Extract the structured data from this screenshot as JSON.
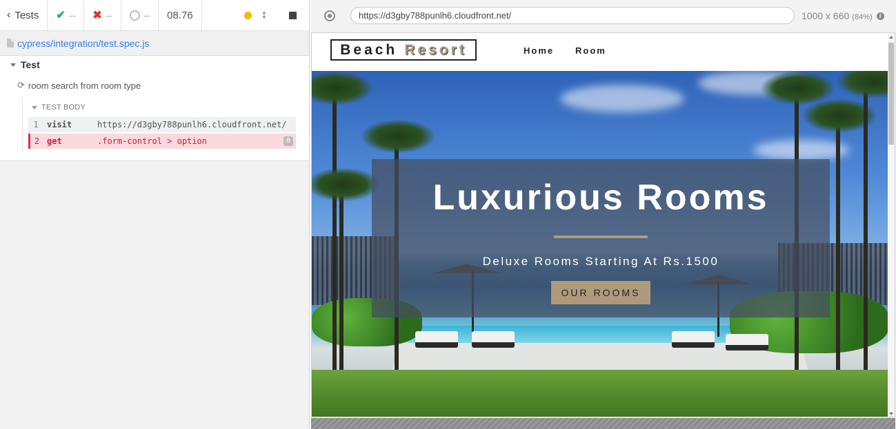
{
  "reporter": {
    "tests_label": "Tests",
    "passed": "--",
    "failed": "--",
    "pending": "--",
    "duration": "08.76",
    "running_dot_color": "#f5b800",
    "spec_path": "cypress/integration/test.spec.js",
    "suite_title": "Test",
    "test_title": "room search from room type",
    "section_label": "TEST BODY",
    "commands": [
      {
        "num": "1",
        "name": "visit",
        "message": "https://d3gby788punlh6.cloudfront.net/",
        "state": "passed"
      },
      {
        "num": "2",
        "name": "get",
        "message": ".form-control > option",
        "badge": "0",
        "state": "failed"
      }
    ]
  },
  "aut": {
    "url": "https://d3gby788punlh6.cloudfront.net/",
    "viewport": "1000 x 660",
    "scale": "(84%)",
    "site": {
      "logo_word1": "Beach",
      "logo_word2": "Resort",
      "nav": [
        "Home",
        "Room"
      ],
      "hero_title": "Luxurious Rooms",
      "hero_subtitle": "Deluxe Rooms Starting At Rs.1500",
      "hero_button": "OUR ROOMS",
      "accent_color": "#af9a7d"
    }
  }
}
